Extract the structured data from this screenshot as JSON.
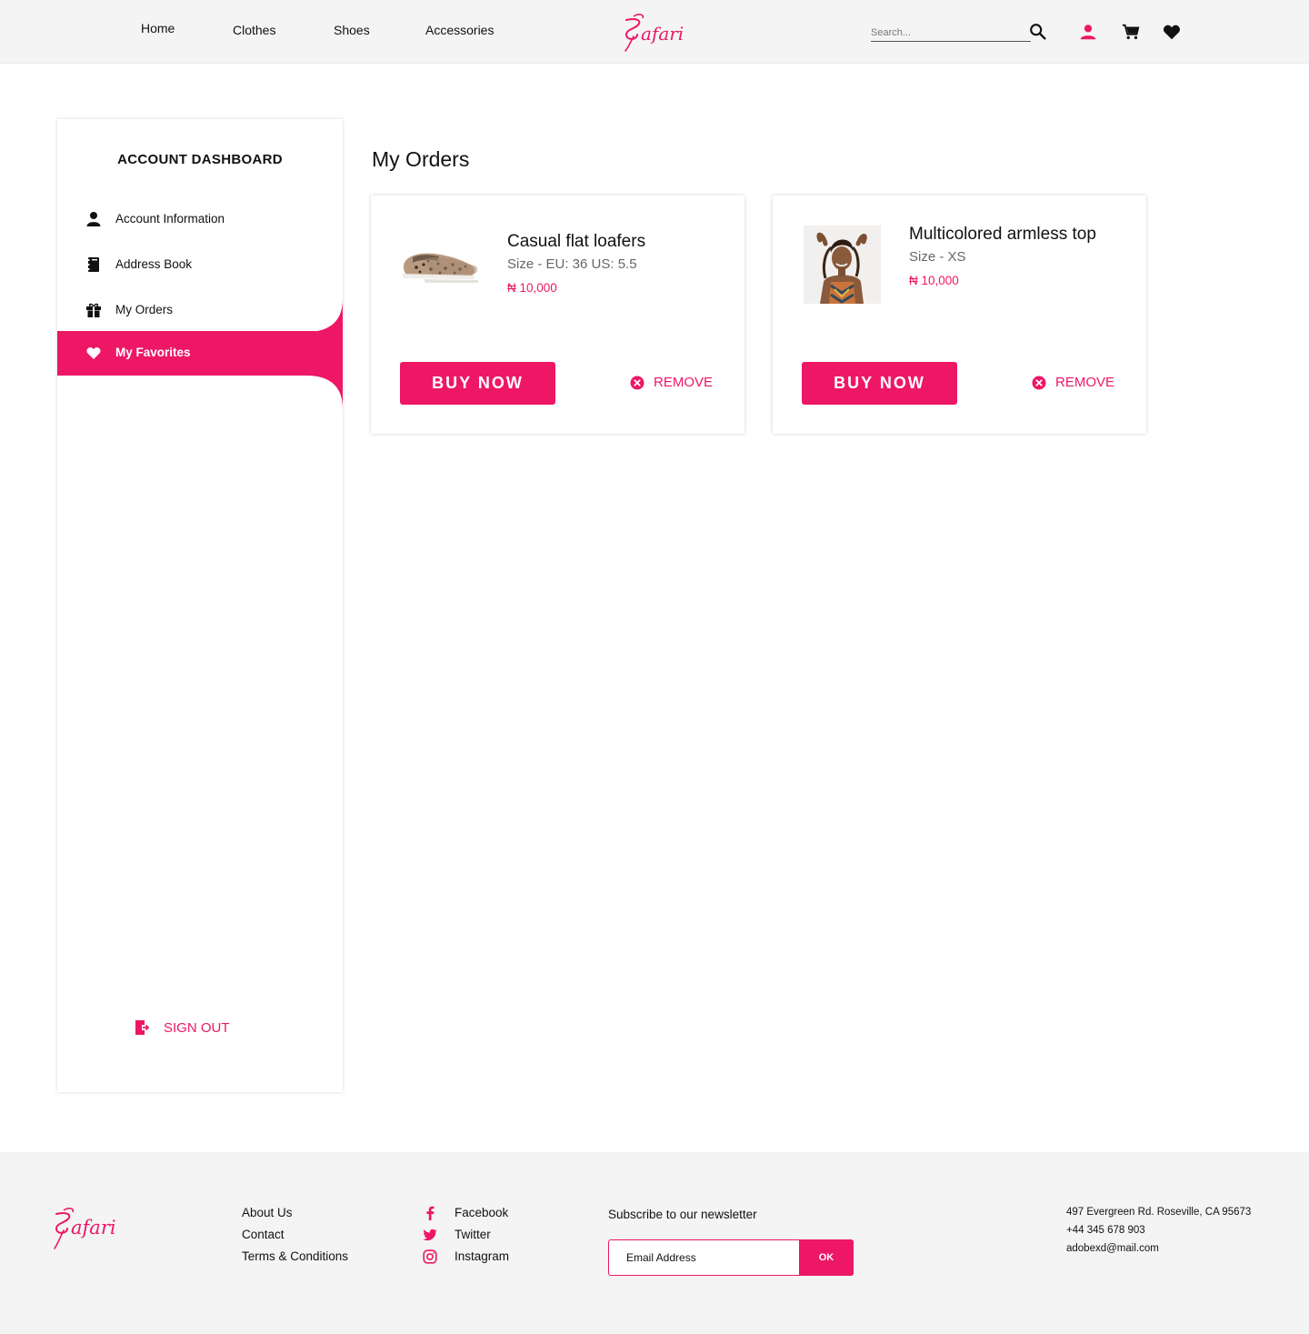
{
  "brand": {
    "name": "Safari",
    "accent": "#ed1766"
  },
  "nav": {
    "items": [
      {
        "label": "Home"
      },
      {
        "label": "Clothes"
      },
      {
        "label": "Shoes"
      },
      {
        "label": "Accessories"
      }
    ],
    "search_placeholder": "Search...",
    "icons": [
      "search-icon",
      "user-icon",
      "cart-icon",
      "heart-icon"
    ]
  },
  "sidebar": {
    "title": "ACCOUNT DASHBOARD",
    "items": [
      {
        "label": "Account Information",
        "icon": "user-icon",
        "active": false
      },
      {
        "label": "Address Book",
        "icon": "address-book-icon",
        "active": false
      },
      {
        "label": "My Orders",
        "icon": "gift-icon",
        "active": false
      },
      {
        "label": "My Favorites",
        "icon": "heart-icon",
        "active": true
      }
    ],
    "sign_out": "SIGN OUT"
  },
  "main": {
    "title": "My Orders",
    "products": [
      {
        "name": "Casual flat loafers",
        "size": "Size - EU: 36 US: 5.5",
        "price": "₦ 10,000",
        "buy_label": "BUY NOW",
        "remove_label": "REMOVE"
      },
      {
        "name": "Multicolored armless top",
        "size": "Size - XS",
        "price": "₦ 10,000",
        "buy_label": "BUY NOW",
        "remove_label": "REMOVE"
      }
    ]
  },
  "footer": {
    "links": [
      "About Us",
      "Contact",
      "Terms & Conditions"
    ],
    "social": [
      {
        "label": "Facebook",
        "icon": "facebook-icon"
      },
      {
        "label": "Twitter",
        "icon": "twitter-icon"
      },
      {
        "label": "Instagram",
        "icon": "instagram-icon"
      }
    ],
    "newsletter": {
      "title": "Subscribe to our newsletter",
      "placeholder": "Email Address",
      "button": "OK"
    },
    "contact": [
      "497 Evergreen Rd. Roseville, CA 95673",
      "+44 345 678 903",
      "adobexd@mail.com"
    ]
  }
}
